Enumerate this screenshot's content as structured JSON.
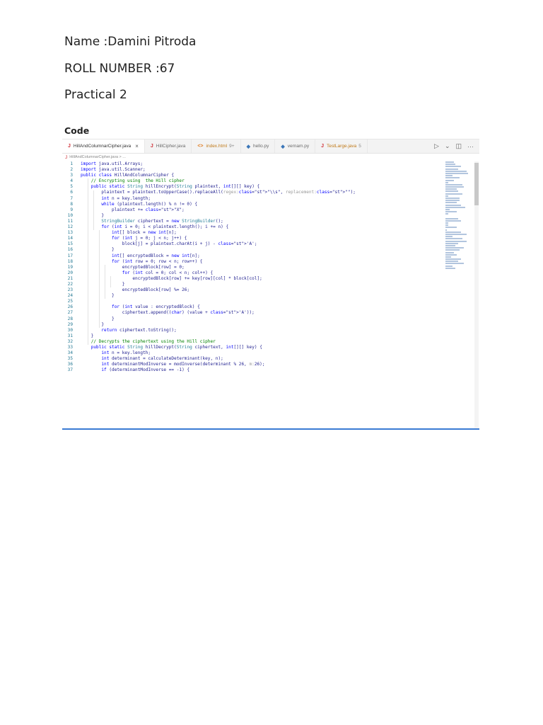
{
  "document": {
    "name_line": "Name :Damini Pitroda",
    "roll_line": "ROLL NUMBER  :67",
    "practical_line": "Practical 2",
    "code_heading": "Code"
  },
  "editor": {
    "tabs": [
      {
        "label": "HillAndColumnarCipher.java",
        "icon": "J",
        "badge": "",
        "close": "×",
        "active": true
      },
      {
        "label": "HillCipher.java",
        "icon": "J",
        "badge": "",
        "close": "",
        "active": false
      },
      {
        "label": "index.html",
        "icon": "<>",
        "badge": "9+",
        "close": "",
        "active": false
      },
      {
        "label": "hello.py",
        "icon": "◆",
        "badge": "",
        "close": "",
        "active": false
      },
      {
        "label": "vernam.py",
        "icon": "◆",
        "badge": "",
        "close": "",
        "active": false
      },
      {
        "label": "TestLarge.java",
        "icon": "J",
        "badge": "5",
        "close": "",
        "active": false
      }
    ],
    "breadcrumb": "HillAndColumnarCipher.java > ...",
    "breadcrumb_icon": "J",
    "actions": {
      "run": "▷",
      "run_menu": "⌄",
      "split": "◫",
      "more": "···"
    },
    "lines": [
      {
        "n": "1",
        "t": "import java.util.Arrays;"
      },
      {
        "n": "2",
        "t": "import java.util.Scanner;"
      },
      {
        "n": "3",
        "t": "public class HillAndColumnarCipher {"
      },
      {
        "n": "4",
        "t": "    // Encrypting using  the Hill cipher"
      },
      {
        "n": "5",
        "t": "    public static String hillEncrypt(String plaintext, int[][] key) {"
      },
      {
        "n": "6",
        "t": "        plaintext = plaintext.toUpperCase().replaceAll(regex:\"\\\\s\", replacement:\"\");"
      },
      {
        "n": "7",
        "t": "        int n = key.length;"
      },
      {
        "n": "8",
        "t": "        while (plaintext.length() % n != 0) {"
      },
      {
        "n": "9",
        "t": "            plaintext += \"X\";"
      },
      {
        "n": "10",
        "t": "        }"
      },
      {
        "n": "11",
        "t": "        StringBuilder ciphertext = new StringBuilder();"
      },
      {
        "n": "12",
        "t": "        for (int i = 0; i < plaintext.length(); i += n) {"
      },
      {
        "n": "13",
        "t": "            int[] block = new int[n];"
      },
      {
        "n": "14",
        "t": "            for (int j = 0; j < n; j++) {"
      },
      {
        "n": "15",
        "t": "                block[j] = plaintext.charAt(i + j) - 'A';"
      },
      {
        "n": "16",
        "t": "            }"
      },
      {
        "n": "17",
        "t": "            int[] encryptedBlock = new int[n];"
      },
      {
        "n": "18",
        "t": "            for (int row = 0; row < n; row++) {"
      },
      {
        "n": "19",
        "t": "                encryptedBlock[row] = 0;"
      },
      {
        "n": "20",
        "t": "                for (int col = 0; col < n; col++) {"
      },
      {
        "n": "21",
        "t": "                    encryptedBlock[row] += key[row][col] * block[col];"
      },
      {
        "n": "22",
        "t": "                }"
      },
      {
        "n": "23",
        "t": "                encryptedBlock[row] %= 26;"
      },
      {
        "n": "24",
        "t": "            }"
      },
      {
        "n": "25",
        "t": ""
      },
      {
        "n": "26",
        "t": "            for (int value : encryptedBlock) {"
      },
      {
        "n": "27",
        "t": "                ciphertext.append((char) (value + 'A'));"
      },
      {
        "n": "28",
        "t": "            }"
      },
      {
        "n": "29",
        "t": "        }"
      },
      {
        "n": "30",
        "t": "        return ciphertext.toString();"
      },
      {
        "n": "31",
        "t": "    }"
      },
      {
        "n": "32",
        "t": "    // Decrypts the ciphertext using the Hill cipher"
      },
      {
        "n": "33",
        "t": "    public static String hillDecrypt(String ciphertext, int[][] key) {"
      },
      {
        "n": "34",
        "t": "        int n = key.length;"
      },
      {
        "n": "35",
        "t": "        int determinant = calculateDeterminant(key, n);"
      },
      {
        "n": "36",
        "t": "        int determinantModInverse = modInverse(determinant % 26, m:26);"
      },
      {
        "n": "37",
        "t": "        if (determinantModInverse == -1) {"
      }
    ]
  }
}
